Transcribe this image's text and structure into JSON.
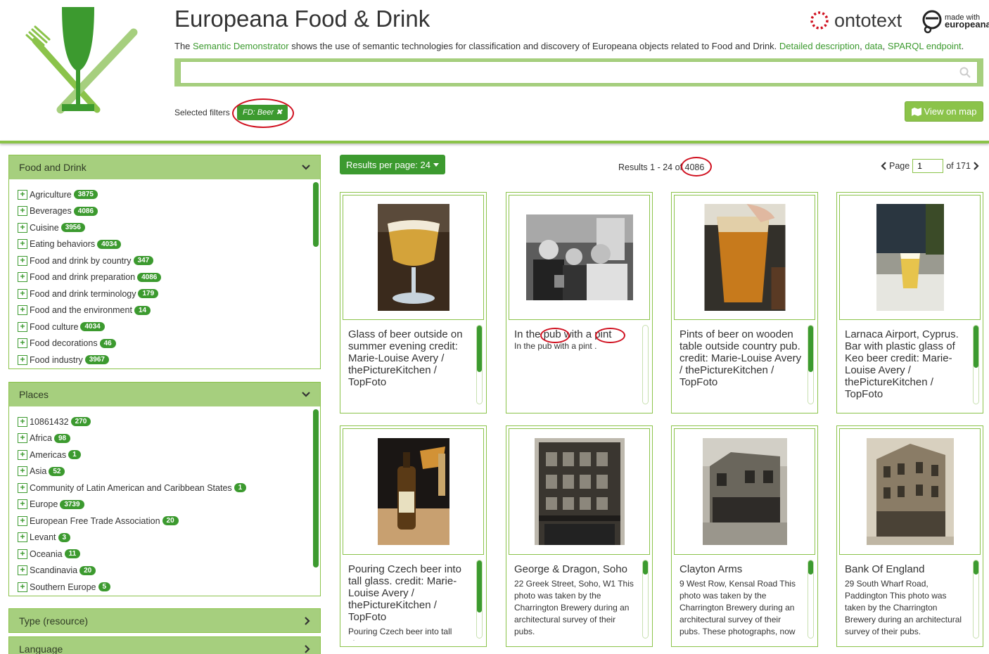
{
  "header": {
    "title": "Europeana Food & Drink",
    "desc_prefix": "The ",
    "demonstrator_link": "Semantic Demonstrator",
    "desc_middle": " shows the use of semantic technologies for classification and discovery of Europeana objects related to Food and Drink. ",
    "detailed_link": "Detailed description",
    "data_link": "data",
    "sparql_link": "SPARQL endpoint",
    "ontotext": "ontotext",
    "made_with": "made with",
    "europeana": "europeana",
    "search_value": "",
    "selected_filters_label": "Selected filters",
    "filter_chip": "FD: Beer",
    "view_on_map": "View on map"
  },
  "facets": {
    "food_and_drink": {
      "title": "Food and Drink",
      "items": [
        {
          "label": "Agriculture",
          "count": "3875"
        },
        {
          "label": "Beverages",
          "count": "4086"
        },
        {
          "label": "Cuisine",
          "count": "3956"
        },
        {
          "label": "Eating behaviors",
          "count": "4034"
        },
        {
          "label": "Food and drink by country",
          "count": "347"
        },
        {
          "label": "Food and drink preparation",
          "count": "4086"
        },
        {
          "label": "Food and drink terminology",
          "count": "179"
        },
        {
          "label": "Food and the environment",
          "count": "14"
        },
        {
          "label": "Food culture",
          "count": "4034"
        },
        {
          "label": "Food decorations",
          "count": "46"
        },
        {
          "label": "Food industry",
          "count": "3967"
        }
      ]
    },
    "places": {
      "title": "Places",
      "items": [
        {
          "label": "10861432",
          "count": "270"
        },
        {
          "label": "Africa",
          "count": "98"
        },
        {
          "label": "Americas",
          "count": "1"
        },
        {
          "label": "Asia",
          "count": "52"
        },
        {
          "label": "Community of Latin American and Caribbean States",
          "count": "1"
        },
        {
          "label": "Europe",
          "count": "3739"
        },
        {
          "label": "European Free Trade Association",
          "count": "20"
        },
        {
          "label": "Levant",
          "count": "3"
        },
        {
          "label": "Oceania",
          "count": "11"
        },
        {
          "label": "Scandinavia",
          "count": "20"
        },
        {
          "label": "Southern Europe",
          "count": "5"
        }
      ]
    },
    "type": {
      "title": "Type (resource)"
    },
    "language": {
      "title": "Language"
    }
  },
  "toolbar": {
    "results_per_page": "Results per page: 24",
    "results_text": "Results 1 - 24 of",
    "results_total": "4086",
    "page_label": "Page",
    "page_value": "1",
    "page_of": "of 171"
  },
  "cards": [
    {
      "title": "Glass of beer outside on summer evening credit: Marie-Louise Avery / thePictureKitchen / TopFoto",
      "desc": ""
    },
    {
      "title_a": "In the ",
      "title_b": "pub",
      "title_c": " with a ",
      "title_d": "pint",
      "desc": "In the pub with a pint ."
    },
    {
      "title": "Pints of beer on wooden table outside country pub. credit: Marie-Louise Avery / thePictureKitchen / TopFoto",
      "desc": ""
    },
    {
      "title": "Larnaca Airport, Cyprus. Bar with plastic glass of Keo beer credit: Marie-Louise Avery / thePictureKitchen / TopFoto",
      "desc": ""
    },
    {
      "title": "Pouring Czech beer into tall glass. credit: Marie-Louise Avery / thePictureKitchen / TopFoto",
      "desc": "Pouring Czech beer into tall glass."
    },
    {
      "title": "George & Dragon, Soho",
      "desc": "22 Greek Street, Soho, W1 This photo was taken by the Charrington Brewery during an architectural survey of their pubs."
    },
    {
      "title": "Clayton Arms",
      "desc": "9 West Row, Kensal Road This photo was taken by the Charrington Brewery during an architectural survey of their pubs. These photographs, now"
    },
    {
      "title": "Bank Of England",
      "desc": "29 South Wharf Road, Paddington This photo was taken by the Charrington Brewery during an architectural survey of their pubs."
    }
  ],
  "colors": {
    "brand_green": "#3c9a2f",
    "light_green": "#8bc34a",
    "panel_header": "#a6cf7e",
    "highlight_ring": "#d0101f"
  }
}
